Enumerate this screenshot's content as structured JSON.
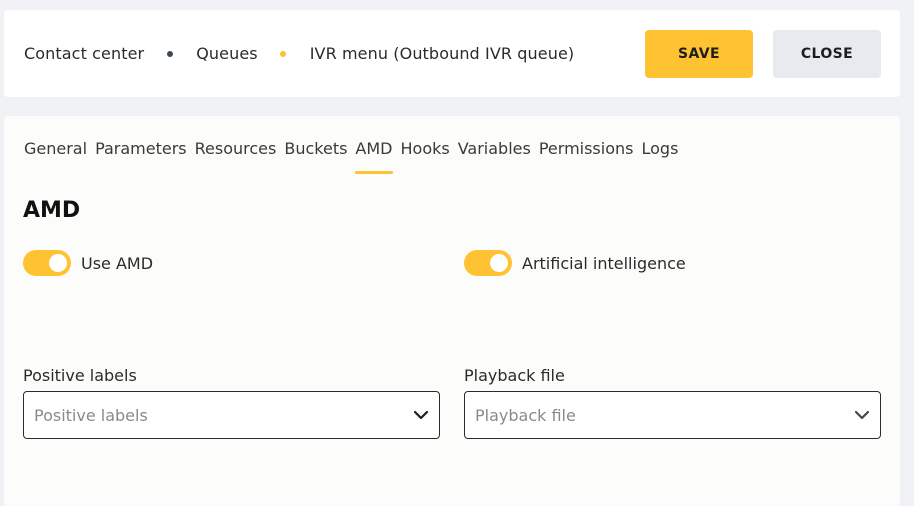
{
  "breadcrumb": {
    "items": [
      "Contact center",
      "Queues",
      "IVR menu (Outbound IVR queue)"
    ]
  },
  "toolbar": {
    "save_label": "SAVE",
    "close_label": "CLOSE"
  },
  "tabs": [
    {
      "label": "General"
    },
    {
      "label": "Parameters"
    },
    {
      "label": "Resources"
    },
    {
      "label": "Buckets"
    },
    {
      "label": "AMD",
      "active": true
    },
    {
      "label": "Hooks"
    },
    {
      "label": "Variables"
    },
    {
      "label": "Permissions"
    },
    {
      "label": "Logs"
    }
  ],
  "section": {
    "title": "AMD"
  },
  "toggles": {
    "use_amd": {
      "label": "Use AMD",
      "on": true
    },
    "ai": {
      "label": "Artificial intelligence",
      "on": true
    }
  },
  "fields": {
    "positive_labels": {
      "label": "Positive labels",
      "placeholder": "Positive labels"
    },
    "playback_file": {
      "label": "Playback file",
      "placeholder": "Playback file"
    }
  },
  "colors": {
    "accent": "#ffc233",
    "secondary_button": "#e7eaee",
    "breadcrumb_dot_1": "#3b4a5a",
    "breadcrumb_dot_2": "#ffc233"
  },
  "icons": {
    "select_chevron": "chevron-down-icon"
  }
}
